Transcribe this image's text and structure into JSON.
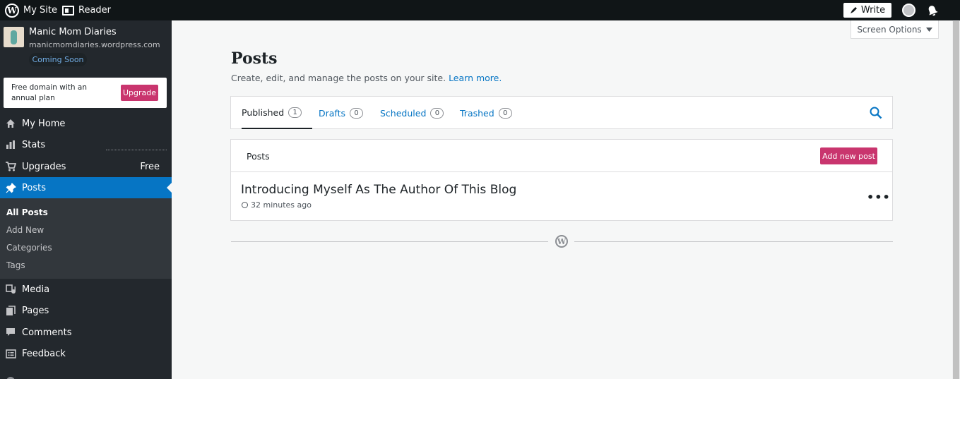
{
  "topbar": {
    "my_site": "My Site",
    "reader": "Reader",
    "write": "Write"
  },
  "site": {
    "name": "Manic Mom Diaries",
    "url": "manicmomdiaries.wordpress.com",
    "status_badge": "Coming Soon"
  },
  "upsell": {
    "text": "Free domain with an annual plan",
    "button": "Upgrade"
  },
  "sidebar": {
    "items": [
      {
        "label": "My Home",
        "icon": "home-icon",
        "right": ""
      },
      {
        "label": "Stats",
        "icon": "bar-chart-icon",
        "right": ""
      },
      {
        "label": "Upgrades",
        "icon": "cart-icon",
        "right": "Free"
      },
      {
        "label": "Posts",
        "icon": "pin-icon",
        "right": ""
      },
      {
        "label": "Media",
        "icon": "media-icon",
        "right": ""
      },
      {
        "label": "Pages",
        "icon": "pages-icon",
        "right": ""
      },
      {
        "label": "Comments",
        "icon": "comment-icon",
        "right": ""
      },
      {
        "label": "Feedback",
        "icon": "feedback-icon",
        "right": ""
      }
    ],
    "submenu": [
      "All Posts",
      "Add New",
      "Categories",
      "Tags"
    ]
  },
  "screen_options": "Screen Options",
  "page": {
    "title": "Posts",
    "subtitle": "Create, edit, and manage the posts on your site.",
    "learn_more": "Learn more."
  },
  "tabs": [
    {
      "label": "Published",
      "count": "1"
    },
    {
      "label": "Drafts",
      "count": "0"
    },
    {
      "label": "Scheduled",
      "count": "0"
    },
    {
      "label": "Trashed",
      "count": "0"
    }
  ],
  "posts": {
    "heading": "Posts",
    "add_new": "Add new post",
    "items": [
      {
        "title": "Introducing Myself As The Author Of This Blog",
        "time": "32 minutes ago"
      }
    ]
  },
  "colors": {
    "sidebar_bg": "#23282d",
    "accent": "#0675c4",
    "brand_pink": "#c9356e",
    "topbar_bg": "#101517"
  }
}
